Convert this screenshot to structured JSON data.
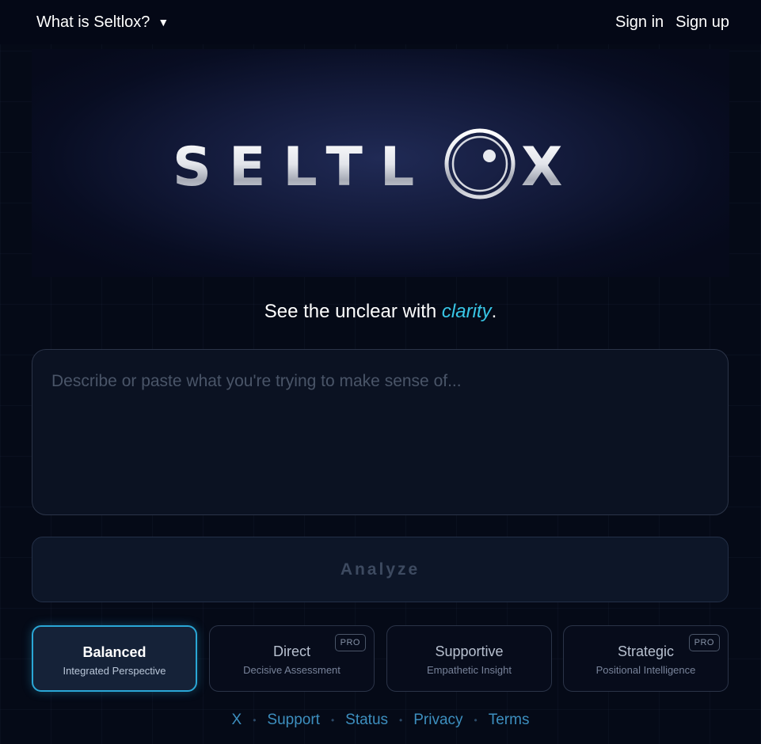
{
  "nav": {
    "about_label": "What is Seltlox?",
    "caret_icon": "caret-down-icon",
    "sign_in": "Sign in",
    "sign_up": "Sign up"
  },
  "hero": {
    "logo_text_left": "SELTL",
    "logo_text_right": "X",
    "logo_icon": "eye-lens-icon"
  },
  "tagline": {
    "before": "See the unclear with ",
    "accent": "clarity",
    "after": "."
  },
  "input": {
    "value": "",
    "placeholder": "Describe or paste what you're trying to make sense of..."
  },
  "analyze_label": "Analyze",
  "modes": [
    {
      "title": "Balanced",
      "subtitle": "Integrated Perspective",
      "pro": false,
      "selected": true
    },
    {
      "title": "Direct",
      "subtitle": "Decisive Assessment",
      "pro": true,
      "pro_label": "PRO",
      "selected": false
    },
    {
      "title": "Supportive",
      "subtitle": "Empathetic Insight",
      "pro": false,
      "selected": false
    },
    {
      "title": "Strategic",
      "subtitle": "Positional Intelligence",
      "pro": true,
      "pro_label": "PRO",
      "selected": false
    }
  ],
  "footer": {
    "links": [
      "X",
      "Support",
      "Status",
      "Privacy",
      "Terms"
    ]
  },
  "colors": {
    "background": "#050a17",
    "accent": "#38c6e6",
    "selected_border": "#2aa7d6",
    "footer_link": "#3d8fbf"
  }
}
